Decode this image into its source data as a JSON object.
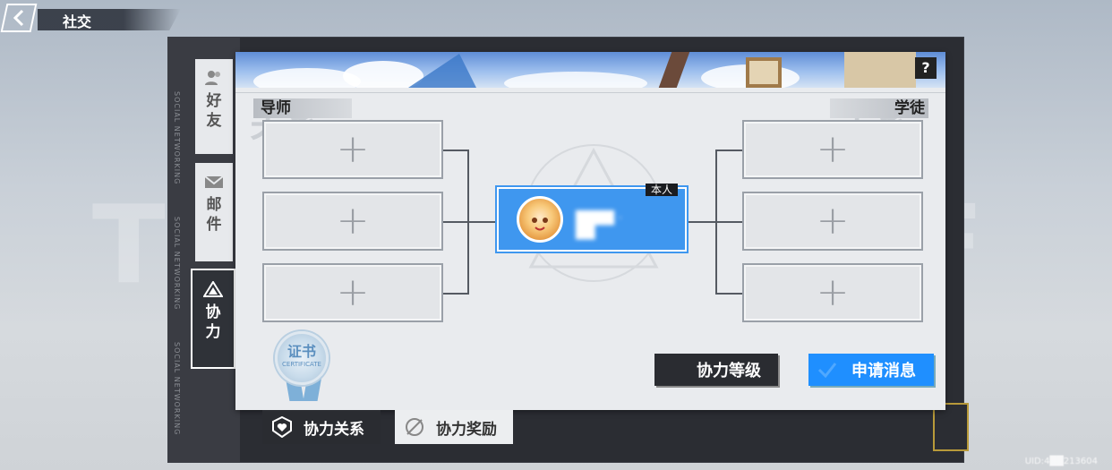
{
  "header": {
    "title": "社交"
  },
  "background_word": "TOWER OF FANTASY",
  "sidebar": {
    "items": [
      {
        "label_1": "好",
        "label_2": "友"
      },
      {
        "label_1": "邮",
        "label_2": "件"
      },
      {
        "label_1": "协",
        "label_2": "力"
      }
    ],
    "vertical_text": "SOCIAL NETWORKING"
  },
  "panel": {
    "help_label": "?",
    "mentor_header": "导师",
    "mentor_bg": "关系",
    "student_header": "学徒",
    "student_bg": "关系",
    "slot_plus": "+",
    "self_badge": "本人",
    "player_name": "████ · ██",
    "buttons": {
      "level": "协力等级",
      "apply": "申请消息"
    },
    "certificate": {
      "title": "证书",
      "subtitle": "CERTIFICATE"
    }
  },
  "bottom_tabs": [
    {
      "label": "协力关系"
    },
    {
      "label": "协力奖励"
    }
  ],
  "uid": "UID:4██213604",
  "colors": {
    "accent_blue": "#3f97ef",
    "button_blue": "#1f8fff",
    "dark": "#2b2d33"
  }
}
